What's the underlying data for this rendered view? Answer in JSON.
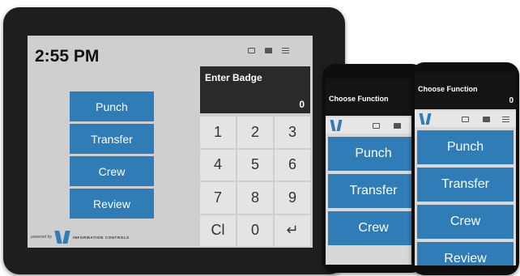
{
  "tablet": {
    "clock": "2:55 PM",
    "functions": [
      "Punch",
      "Transfer",
      "Crew",
      "Review"
    ],
    "badge_label": "Enter Badge",
    "badge_value": "0",
    "keys": [
      "1",
      "2",
      "3",
      "4",
      "5",
      "6",
      "7",
      "8",
      "9",
      "Cl",
      "0",
      "↵"
    ],
    "powered_by": "powered by",
    "logo_text": "INFORMATION CONTROLS"
  },
  "phone_small": {
    "title": "Choose Function",
    "functions": [
      "Punch",
      "Transfer",
      "Crew"
    ]
  },
  "phone_large": {
    "title": "Choose Function",
    "badge_value": "0",
    "functions": [
      "Punch",
      "Transfer",
      "Crew",
      "Review"
    ]
  },
  "colors": {
    "accent": "#2f7cb6",
    "screen_bg": "#cfcfcf",
    "badge_bg": "#2a2a2a",
    "key_bg": "#e4e4e4"
  },
  "icons": [
    "folder-icon",
    "briefcase-icon",
    "menu-icon",
    "info-controls-logo-icon",
    "enter-icon"
  ]
}
